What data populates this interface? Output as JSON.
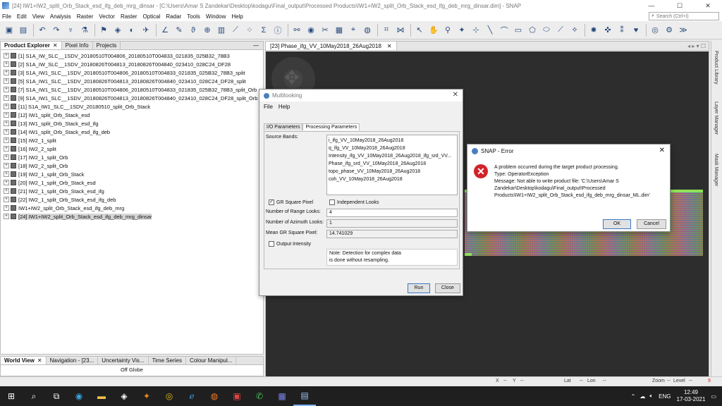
{
  "window": {
    "title": "[24] IW1+IW2_split_Orb_Stack_esd_ifg_deb_mrg_dinsar - [C:\\Users\\Amar S Zandekar\\Desktop\\kodagu\\Final_output\\Processed Products\\IW1+IW2_split_Orb_Stack_esd_ifg_deb_mrg_dinsar.dim] - SNAP",
    "minimize": "—",
    "maximize": "☐",
    "close": "✕"
  },
  "menu": [
    "File",
    "Edit",
    "View",
    "Analysis",
    "Raster",
    "Vector",
    "Raster",
    "Optical",
    "Radar",
    "Tools",
    "Window",
    "Help"
  ],
  "search": {
    "placeholder": "Search (Ctrl+I)"
  },
  "left_tabs": [
    "Product Explorer",
    "Pixel Info",
    "Projects"
  ],
  "products": [
    "[1] S1A_IW_SLC__1SDV_20180510T004806_20180510T004833_021835_025B32_78B3",
    "[2] S1A_IW_SLC__1SDV_20180826T004813_20180826T004840_023410_028C24_DF28",
    "[3] S1A_IW1_SLC__1SDV_20180510T004806_20180510T004833_021835_025B32_78B3_split",
    "[5] S1A_IW1_SLC__1SDV_20180826T004813_20180826T004840_023410_028C24_DF28_split",
    "[7] S1A_IW1_SLC__1SDV_20180510T004806_20180510T004833_021835_025B32_78B3_split_Orb",
    "[9] S1A_IW1_SLC__1SDV_20180826T004813_20180826T004840_023410_028C24_DF28_split_Orb",
    "[11] S1A_IW1_SLC__1SDV_20180510_split_Orb_Stack",
    "[12] IW1_split_Orb_Stack_esd",
    "[13] IW1_split_Orb_Stack_esd_ifg",
    "[14] IW1_split_Orb_Stack_esd_ifg_deb",
    "[15] IW2_1_split",
    "[16] IW2_2_split",
    "[17] IW2_1_split_Orb",
    "[18] IW2_2_split_Orb",
    "[19] IW2_1_split_Orb_Stack",
    "[20] IW2_1_split_Orb_Stack_esd",
    "[21] IW2_1_split_Orb_Stack_esd_ifg",
    "[22] IW2_1_split_Orb_Stack_esd_ifg_deb",
    "IW1+IW2_split_Orb_Stack_esd_ifg_deb_mrg",
    "[24] IW1+IW2_split_Orb_Stack_esd_ifg_deb_mrg_dinsar"
  ],
  "bottom_tabs": [
    "World View",
    "Navigation - [23...",
    "Uncertainty Vis...",
    "Time Series",
    "Colour Manipul..."
  ],
  "world_view_label": "Off Globe",
  "editor": {
    "tab": "[23] Phase_ifg_VV_10May2018_26Aug2018"
  },
  "right_rail": [
    "Product Library",
    "Layer Manager",
    "Mask Manager"
  ],
  "status": {
    "x": "X",
    "x_val": "--",
    "y": "Y",
    "y_val": "--",
    "lat": "Lat",
    "lat_val": "--",
    "lon": "Lon",
    "lon_val": "--",
    "zoom": "Zoom",
    "zoom_val": "--",
    "level": "Level",
    "level_val": "--"
  },
  "multilook": {
    "title": "Multilooking",
    "menu_file": "File",
    "menu_help": "Help",
    "tab_io": "I/O Parameters",
    "tab_proc": "Processing Parameters",
    "source_bands_label": "Source Bands:",
    "bands": [
      "i_ifg_VV_10May2018_26Aug2018",
      "q_ifg_VV_10May2018_26Aug2018",
      "Intensity_ifg_VV_10May2018_26Aug2018_ifg_srd_VV...",
      "Phase_ifg_srd_VV_10May2018_26Aug2018",
      "topo_phase_VV_10May2018_26Aug2018",
      "coh_VV_10May2018_26Aug2018"
    ],
    "gr_square": "GR Square Pixel",
    "independent": "Independent Looks",
    "range_label": "Number of Range Looks:",
    "range_val": "4",
    "azimuth_label": "Number of Azimuth Looks:",
    "azimuth_val": "1",
    "mean_label": "Mean GR Square Pixel:",
    "mean_val": "14.741029",
    "output_intensity": "Output Intensity",
    "note_1": "Note: Detection for complex data",
    "note_2": "is done without resampling.",
    "run": "Run",
    "close": "Close"
  },
  "error": {
    "title": "SNAP - Error",
    "line1": "A problem occurred during the target product processing.",
    "line2": "Type: OperatorException",
    "line3": "Message: Not able to write product file: 'C:\\Users\\Amar S Zandekar\\Desktop\\kodagu\\Final_output\\Processed Products\\IW1+IW2_split_Orb_Stack_esd_ifg_deb_mrg_dinsar_ML.dim'",
    "ok": "OK",
    "cancel": "Cancel"
  },
  "taskbar": {
    "time": "12:49",
    "date": "17-03-2021",
    "lang": "ENG",
    "notifications": "9"
  }
}
